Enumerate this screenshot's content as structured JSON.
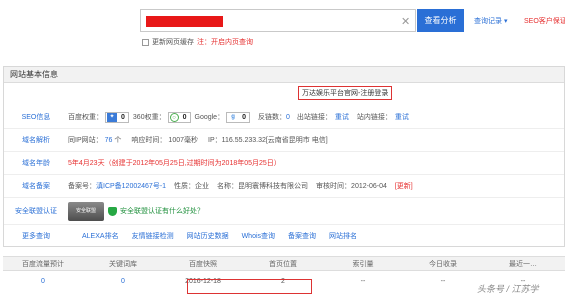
{
  "search": {
    "clear_icon": "✕",
    "button": "查看分析",
    "history": "查询记录",
    "history_icon": "▾",
    "seo_link": "SEO客户保证",
    "checkbox_label": "更新网页缓存",
    "checkbox_note": "注：开启内页查询"
  },
  "panel": {
    "title": "网站基本信息",
    "notice": "万达娱乐平台官网-注册登录"
  },
  "seo": {
    "label": "SEO信息",
    "baidu_label": "百度权重：",
    "baidu_value": "0",
    "w360_label": "360权重：",
    "w360_value": "0",
    "google_label": "Google：",
    "google_value": "0",
    "backlinks_label": "反链数：",
    "backlinks_value": "0",
    "outlinks_label": "出站链接：",
    "outlinks_action": "重试",
    "inlinks_label": "站内链接：",
    "inlinks_action": "重试"
  },
  "dns": {
    "label": "域名解析",
    "sameip_label": "同IP网站：",
    "sameip_value": "76",
    "sameip_unit": "个",
    "resp_label": "响应时间：",
    "resp_value": "1007毫秒",
    "ip_text": "IP：116.55.233.32[云南省昆明市 电信]"
  },
  "age": {
    "label": "域名年龄",
    "text": "5年4月23天（创建于2012年05月25日,过期时间为2018年05月25日）"
  },
  "icp": {
    "label": "域名备案",
    "no_label": "备案号：",
    "no_value": "滇ICP备12002467号-1",
    "nature_label": "性质：",
    "nature_value": "企业",
    "name_label": "名称：",
    "name_value": "昆明寰博科技有限公司",
    "time_label": "审核时间：",
    "time_value": "2012-06-04",
    "query": "[更新]"
  },
  "security": {
    "label": "安全联盟认证",
    "seal_text": "安全联盟",
    "text": "安全联盟认证有什么好处？"
  },
  "more": {
    "label": "更多查询",
    "tools": [
      "ALEXA排名",
      "友情链接检测",
      "网站历史数据",
      "Whois查询",
      "备案查询",
      "网站排名"
    ]
  },
  "table": {
    "headers": [
      "百度流量预计",
      "关键词库",
      "百度快照",
      "首页位置",
      "索引量",
      "今日收录",
      "最近一…"
    ],
    "values": [
      "0",
      "0",
      "2016-12-18",
      "2",
      "--",
      "--",
      "--"
    ]
  },
  "watermark": "头条号 / 江苏学"
}
